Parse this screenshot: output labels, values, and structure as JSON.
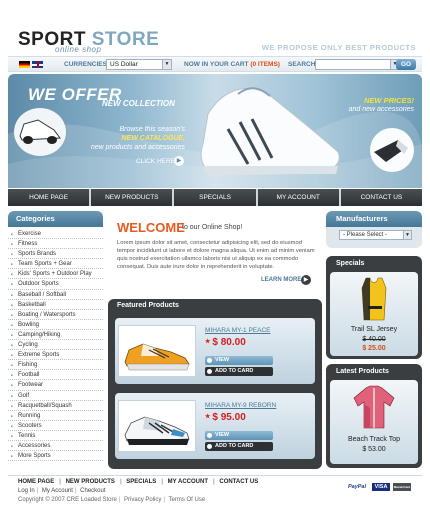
{
  "header": {
    "logo_word1": "SPORT",
    "logo_word2": "STORE",
    "logo_sub": "online shop",
    "tagline": "WE PROPOSE ONLY BEST PRODUCTS"
  },
  "topbar": {
    "currencies_label": "CURRENCIES:",
    "currency_value": "US Dollar",
    "cart_label": "NOW IN YOUR CART",
    "cart_items": "(0 ITEMS)",
    "search_label": "SEARCH",
    "search_value": "",
    "go_label": "GO"
  },
  "banner": {
    "headline": "WE OFFER",
    "subheadline": "NEW COLLECTION",
    "browse_line1": "Browse this season's",
    "browse_highlight": "NEW CATALOGUE,",
    "browse_line3": "new products and accessories",
    "click_here": "CLICK HERE",
    "new_prices": "NEW PRICES!",
    "new_accessories": "and new accessories"
  },
  "nav": {
    "items": [
      "HOME PAGE",
      "NEW PRODUCTS",
      "SPECIALS",
      "MY ACCOUNT",
      "CONTACT US"
    ]
  },
  "categories": {
    "title": "Categories",
    "items": [
      "Exercise",
      "Fitness",
      "Sports Brands",
      "Team Sports + Gear",
      "Kids' Sports + Outdoor Play",
      "Outdoor Sports",
      "Baseball / Softball",
      "Basketball",
      "Boating / Watersports",
      "Bowling",
      "Camping/Hiking",
      "Cycling",
      "Extreme Sports",
      "Fishing",
      "Football",
      "Footwear",
      "Golf",
      "Racquetball/Squash",
      "Running",
      "Scooters",
      "Tennis",
      "Accessories",
      "More Sports"
    ]
  },
  "welcome": {
    "title": "WELCOME",
    "subtitle": "to our Online Shop!",
    "body": "Lorem ipsum dolor sit amet, consectetur adipisicing elit, sed do eiusmod tempor incididunt ut labore et dolore magna aliqua. Ut enim ad minim veniam quis nostrud exercitation ullamco laboris nisi ut aliquip ex ea commodo consequat. Duis aute irure dolor in reprehenderit in voluptate.",
    "learn_more": "LEARN MORE"
  },
  "featured": {
    "title": "Featured Products",
    "view_label": "VIEW",
    "add_label": "ADD TO CARD",
    "products": [
      {
        "name": "MIHARA MY-1 PEACE",
        "price": "$ 80.00"
      },
      {
        "name": "MIHARA MY-9 REBORN",
        "price": "$ 95.00"
      }
    ]
  },
  "manufacturers": {
    "title": "Manufacturers",
    "select_value": "- Please Select -"
  },
  "specials": {
    "title": "Specials",
    "product_name": "Trail SL Jersey",
    "old_price": "$ 40.00",
    "new_price": "$ 25.00"
  },
  "latest": {
    "title": "Latest Products",
    "product_name": "Beach Track Top",
    "price": "$ 53.00"
  },
  "footer": {
    "nav": [
      "HOME PAGE",
      "NEW PRODUCTS",
      "SPECIALS",
      "MY ACCOUNT",
      "CONTACT US"
    ],
    "links": [
      "Log In",
      "My Account",
      "Checkout"
    ],
    "copyright": "Copyright © 2007 CRE Loaded Store",
    "privacy": "Privacy Policy",
    "terms": "Terms Of Use",
    "payments": [
      "PayPal",
      "VISA",
      "MasterCard"
    ]
  },
  "colors": {
    "accent_orange": "#e85a1e",
    "steel_blue": "#457796",
    "dark_panel": "#3a3e41",
    "price_red": "#d41e1e"
  }
}
